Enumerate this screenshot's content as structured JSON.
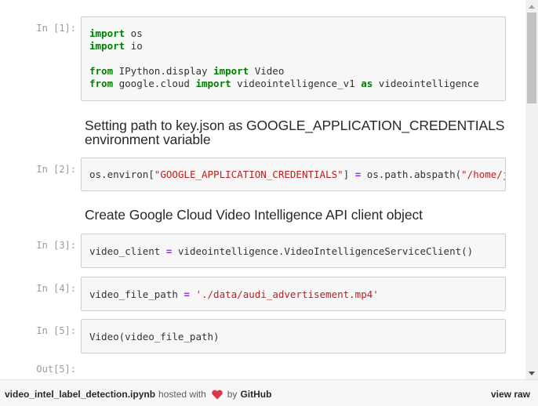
{
  "cells": {
    "c1": {
      "prompt": "In [1]:",
      "lines": [
        [
          {
            "k": "kw",
            "t": "import"
          },
          {
            "k": "",
            "t": " os"
          }
        ],
        [
          {
            "k": "kw",
            "t": "import"
          },
          {
            "k": "",
            "t": " io"
          }
        ],
        [],
        [
          {
            "k": "kw",
            "t": "from"
          },
          {
            "k": "",
            "t": " IPython.display "
          },
          {
            "k": "kw",
            "t": "import"
          },
          {
            "k": "",
            "t": " Video"
          }
        ],
        [
          {
            "k": "kw",
            "t": "from"
          },
          {
            "k": "",
            "t": " google.cloud "
          },
          {
            "k": "kw",
            "t": "import"
          },
          {
            "k": "",
            "t": " videointelligence_v1 "
          },
          {
            "k": "kw",
            "t": "as"
          },
          {
            "k": "",
            "t": " videointelligence"
          }
        ]
      ]
    },
    "md1": {
      "text": "Setting path to key.json as GOOGLE_APPLICATION_CREDENTIALS environment variable"
    },
    "c2": {
      "prompt": "In [2]:",
      "lines": [
        [
          {
            "k": "",
            "t": "os.environ["
          },
          {
            "k": "str",
            "t": "\"GOOGLE_APPLICATION_CREDENTIALS\""
          },
          {
            "k": "",
            "t": "] "
          },
          {
            "k": "op",
            "t": "="
          },
          {
            "k": "",
            "t": " os.path.abspath("
          },
          {
            "k": "str",
            "t": "\"/home/jupyter/key.json\""
          },
          {
            "k": "",
            "t": ")"
          }
        ]
      ]
    },
    "md2": {
      "text": "Create Google Cloud Video Intelligence API client object"
    },
    "c3": {
      "prompt": "In [3]:",
      "lines": [
        [
          {
            "k": "",
            "t": "video_client "
          },
          {
            "k": "op",
            "t": "="
          },
          {
            "k": "",
            "t": " videointelligence.VideoIntelligenceServiceClient()"
          }
        ]
      ]
    },
    "c4": {
      "prompt": "In [4]:",
      "lines": [
        [
          {
            "k": "",
            "t": "video_file_path "
          },
          {
            "k": "op",
            "t": "="
          },
          {
            "k": "",
            "t": " "
          },
          {
            "k": "str",
            "t": "'./data/audi_advertisement.mp4'"
          }
        ]
      ]
    },
    "c5": {
      "prompt": "In [5]:",
      "lines": [
        [
          {
            "k": "",
            "t": "Video(video_file_path)"
          }
        ]
      ]
    },
    "out5": {
      "prompt": "Out[5]:"
    }
  },
  "footer": {
    "filename": "video_intel_label_detection.ipynb",
    "hosted_with": "hosted with",
    "by": "by",
    "github": "GitHub",
    "view_raw": "view raw",
    "heart_color": "#d73a49"
  }
}
